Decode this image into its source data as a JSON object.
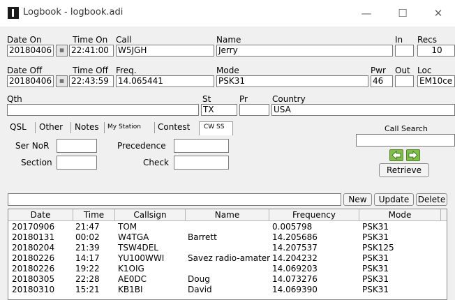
{
  "window": {
    "title": "Logbook - logbook.adi",
    "minimize": "—",
    "maximize": "☐",
    "close": "✕"
  },
  "labels": {
    "date_on": "Date On",
    "time_on": "Time On",
    "call": "Call",
    "name": "Name",
    "in": "In",
    "recs": "Recs",
    "date_off": "Date Off",
    "time_off": "Time Off",
    "freq": "Freq.",
    "mode": "Mode",
    "pwr": "Pwr",
    "out": "Out",
    "loc": "Loc",
    "qth": "Qth",
    "st": "St",
    "pr": "Pr",
    "country": "Country"
  },
  "values": {
    "date_on": "20180406",
    "time_on": "22:41:00",
    "call": "W5JGH",
    "name": "Jerry",
    "in": "",
    "recs": "10",
    "date_off": "20180406",
    "time_off": "22:43:59",
    "freq": "14.065441",
    "mode": "PSK31",
    "pwr": "46",
    "out": "",
    "loc": "EM10ce",
    "qth": "",
    "st": "TX",
    "pr": "",
    "country": "USA"
  },
  "calendar_icon_glyph": "▦",
  "tabs": [
    {
      "label": "QSL"
    },
    {
      "label": "Other"
    },
    {
      "label": "Notes"
    },
    {
      "label": "My Station"
    },
    {
      "label": "Contest"
    },
    {
      "label": "CW SS"
    }
  ],
  "cwss": {
    "ser_nor": "Ser NoR",
    "section": "Section",
    "precedence": "Precedence",
    "check": "Check"
  },
  "call_search": {
    "title": "Call Search",
    "value": "",
    "retrieve": "Retrieve"
  },
  "actions": {
    "search_value": "",
    "new": "New",
    "update": "Update",
    "delete": "Delete"
  },
  "table": {
    "headers": [
      "Date",
      "Time",
      "Callsign",
      "Name",
      "Frequency",
      "Mode"
    ],
    "rows": [
      [
        "20170906",
        "21:47",
        "TOM",
        "",
        "0.005798",
        "PSK31"
      ],
      [
        "20180131",
        "00:02",
        "W4TGA",
        "Barrett",
        "14.205686",
        "PSK31"
      ],
      [
        "20180204",
        "21:39",
        "TSW4DEL",
        "",
        "14.207537",
        "PSK125"
      ],
      [
        "20180226",
        "14:17",
        "YU100WWI",
        "Savez radio-amatera",
        "14.204232",
        "PSK31"
      ],
      [
        "20180226",
        "19:22",
        "K1OIG",
        "",
        "14.069203",
        "PSK31"
      ],
      [
        "20180305",
        "22:28",
        "AE0DC",
        "Doug",
        "14.073276",
        "PSK31"
      ],
      [
        "20180310",
        "15:21",
        "KB1BI",
        "David",
        "14.069390",
        "PSK31"
      ]
    ]
  },
  "colors": {
    "arrow_green": "#7cc044"
  }
}
